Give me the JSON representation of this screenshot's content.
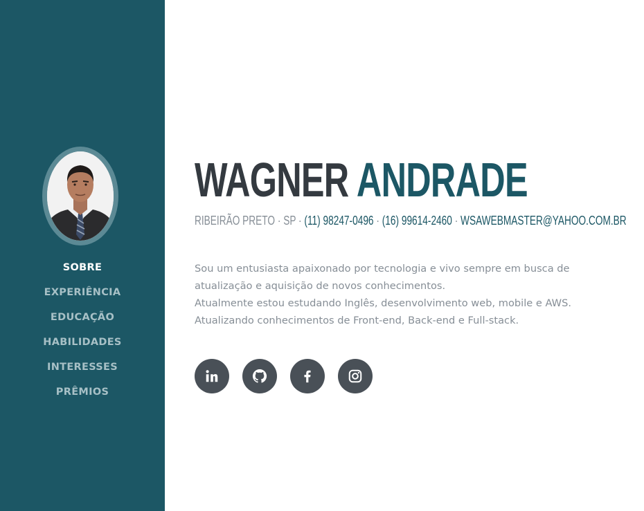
{
  "profile": {
    "first_name": "WAGNER",
    "last_name": "ANDRADE",
    "location": "RIBEIRÃO PRETO · SP ·",
    "phone_1": "(11) 98247-0496",
    "phone_2": "(16) 99614-2460",
    "email": "WSAWEBMASTER@YAHOO.COM.BR",
    "separator": "·"
  },
  "sidebar": {
    "items": [
      {
        "label": "SOBRE",
        "active": true
      },
      {
        "label": "EXPERIÊNCIA",
        "active": false
      },
      {
        "label": "EDUCAÇÃO",
        "active": false
      },
      {
        "label": "HABILIDADES",
        "active": false
      },
      {
        "label": "INTERESSES",
        "active": false
      },
      {
        "label": "PRÊMIOS",
        "active": false
      }
    ]
  },
  "bio": {
    "lines": [
      "Sou um entusiasta apaixonado por tecnologia e vivo sempre em busca de",
      "atualização e aquisição de novos conhecimentos.",
      "Atualmente estou estudando Inglês, desenvolvimento web, mobile e AWS.",
      "Atualizando conhecimentos de Front-end, Back-end e Full-stack."
    ]
  },
  "social": [
    {
      "icon": "linkedin-icon"
    },
    {
      "icon": "github-icon"
    },
    {
      "icon": "facebook-icon"
    },
    {
      "icon": "instagram-icon"
    }
  ],
  "colors": {
    "sidebar_bg": "#1c5765",
    "accent": "#1c5765",
    "heading_dark": "#343a40",
    "muted_text": "#868e96",
    "social_bg": "#495057",
    "nav_inactive": "#a7c0c6",
    "nav_active": "#ffffff"
  }
}
